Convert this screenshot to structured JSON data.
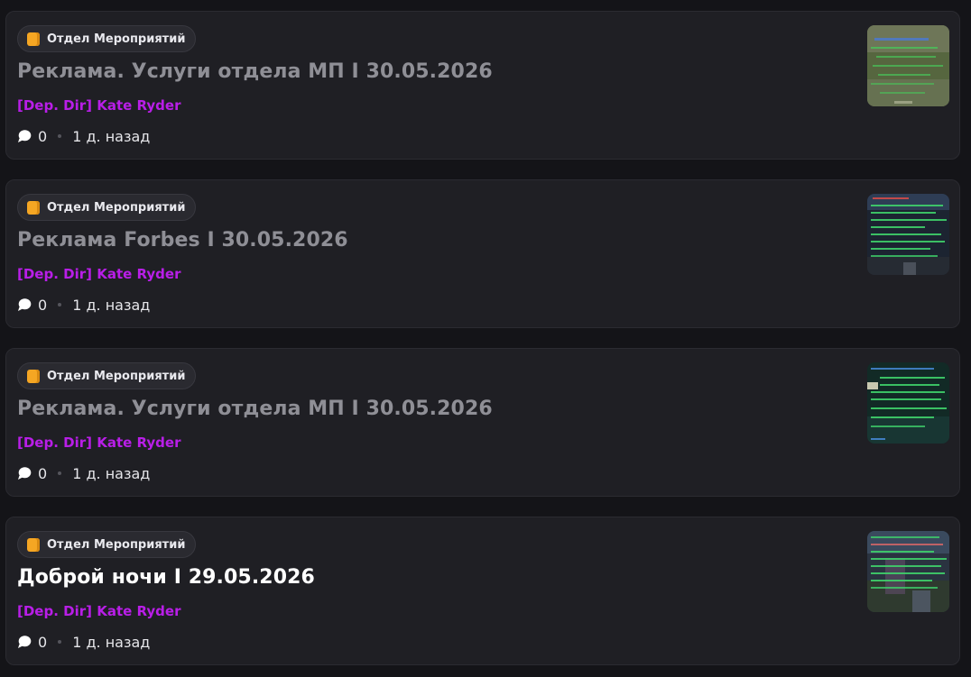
{
  "posts": [
    {
      "category": "Отдел Мероприятий",
      "title": "Реклама. Услуги отдела МП I 30.05.2026",
      "author": "[Dep. Dir] Kate Ryder",
      "comments": "0",
      "time": "1 д. назад",
      "read": true
    },
    {
      "category": "Отдел Мероприятий",
      "title": "Реклама Forbes I 30.05.2026",
      "author": "[Dep. Dir] Kate Ryder",
      "comments": "0",
      "time": "1 д. назад",
      "read": true
    },
    {
      "category": "Отдел Мероприятий",
      "title": "Реклама. Услуги отдела МП I 30.05.2026",
      "author": "[Dep. Dir] Kate Ryder",
      "comments": "0",
      "time": "1 д. назад",
      "read": true
    },
    {
      "category": "Отдел Мероприятий",
      "title": "Доброй ночи I 29.05.2026",
      "author": "[Dep. Dir] Kate Ryder",
      "comments": "0",
      "time": "1 д. назад",
      "read": false
    }
  ],
  "icons": {
    "category": "orange-book-icon",
    "comments": "speech-bubble-icon",
    "thumbnail": "screenshot-thumbnail"
  },
  "colors": {
    "background": "#141418",
    "card": "#1f1f24",
    "author": "#b91ee8",
    "category_icon": "#f5a623",
    "title_read": "#8f8f96",
    "title_unread": "#ffffff"
  }
}
